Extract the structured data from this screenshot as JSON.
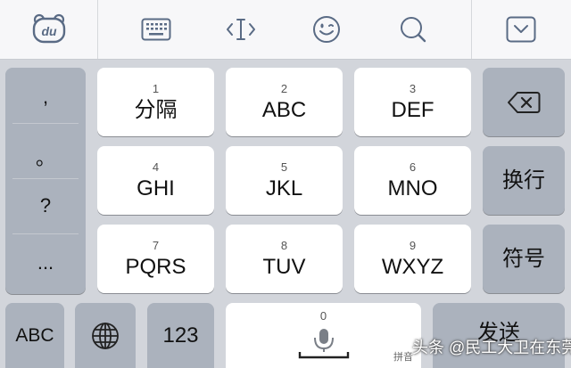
{
  "toolbar": {
    "logo_text": "du",
    "icons": [
      "baidu-logo-icon",
      "keyboard-icon",
      "text-cursor-icon",
      "emoji-icon",
      "search-icon",
      "collapse-icon"
    ]
  },
  "punctuation": [
    ",",
    "。",
    "?",
    "..."
  ],
  "keys_row1": [
    {
      "num": "1",
      "label": "分隔"
    },
    {
      "num": "2",
      "label": "ABC"
    },
    {
      "num": "3",
      "label": "DEF"
    }
  ],
  "keys_row2": [
    {
      "num": "4",
      "label": "GHI"
    },
    {
      "num": "5",
      "label": "JKL"
    },
    {
      "num": "6",
      "label": "MNO"
    }
  ],
  "keys_row3": [
    {
      "num": "7",
      "label": "PQRS"
    },
    {
      "num": "8",
      "label": "TUV"
    },
    {
      "num": "9",
      "label": "WXYZ"
    }
  ],
  "right_keys": {
    "newline": "换行",
    "symbols": "符号"
  },
  "bottom": {
    "abc": "ABC",
    "num123": "123",
    "space_num": "0",
    "send": "发送",
    "pinyin_hint": "拼音"
  },
  "watermark": "头条 @民工大卫在东莞",
  "colors": {
    "key_white": "#ffffff",
    "key_gray": "#abb2bd",
    "background": "#d2d5db"
  }
}
